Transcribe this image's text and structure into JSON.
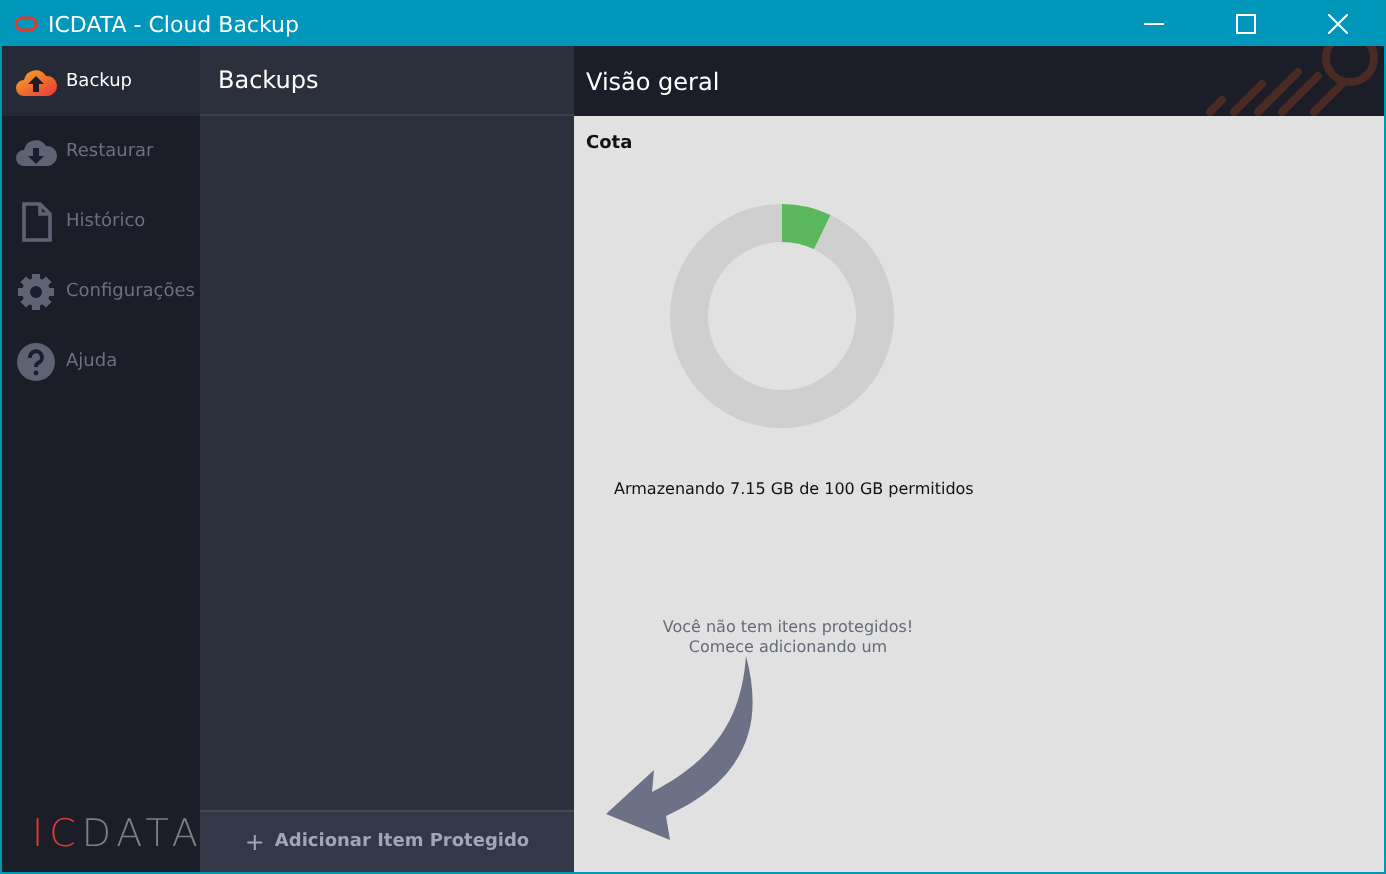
{
  "window": {
    "title": "ICDATA - Cloud Backup"
  },
  "sidebar": {
    "items": [
      {
        "kind": "upload",
        "label": "Backup",
        "selected": true
      },
      {
        "kind": "download",
        "label": "Restaurar",
        "selected": false
      },
      {
        "kind": "file",
        "label": "Histórico",
        "selected": false
      },
      {
        "kind": "gear",
        "label": "Configurações",
        "selected": false
      },
      {
        "kind": "help",
        "label": "Ajuda",
        "selected": false
      }
    ],
    "logo": {
      "accent": "IC",
      "rest": "DATA"
    }
  },
  "backups": {
    "title": "Backups",
    "add_button": {
      "icon": "+",
      "label": "Adicionar Item Protegido"
    }
  },
  "overview": {
    "title": "Visão geral",
    "quota": {
      "title": "Cota",
      "chart_data": {
        "type": "donut",
        "values": [
          7.15,
          92.85
        ]
      },
      "caption": "Armazenando 7.15 GB de 100 GB permitidos"
    },
    "empty_message": [
      "Você não tem itens protegidos!",
      "Comece adicionando um"
    ]
  }
}
